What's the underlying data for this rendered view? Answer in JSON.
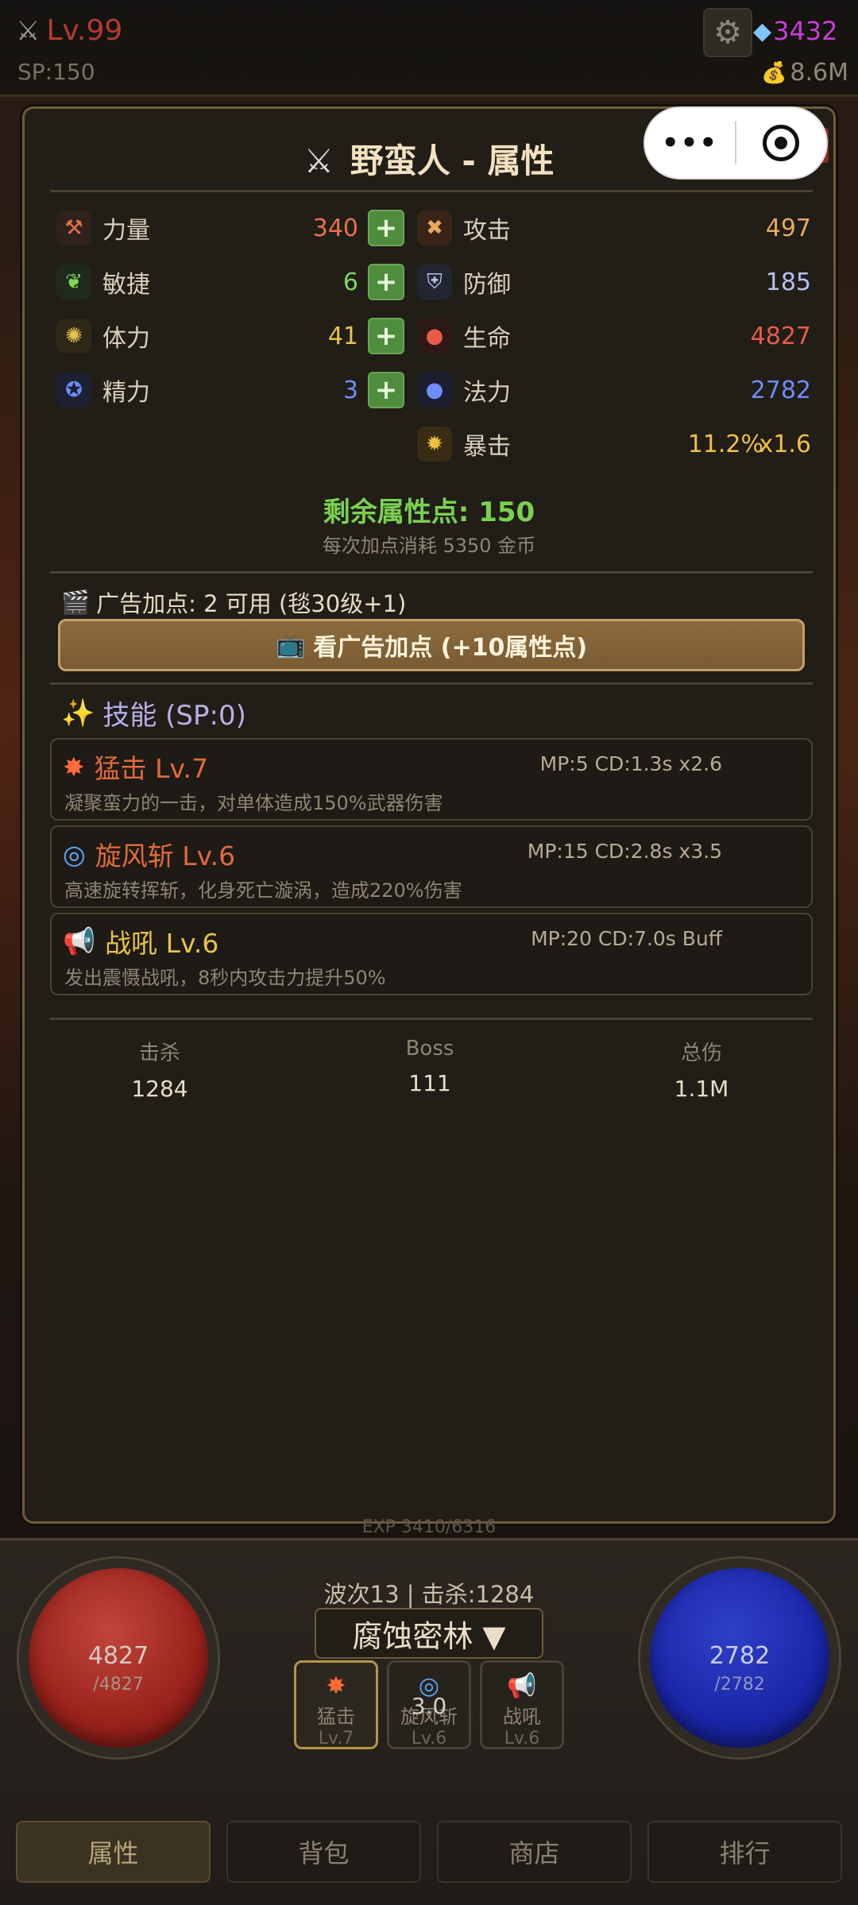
{
  "hud": {
    "level": "Lv.99",
    "sp": "SP:150",
    "gems": "3432",
    "gold": "8.6M"
  },
  "panel": {
    "title": "野蛮人 - 属性",
    "close_label": "X"
  },
  "mini_program": {
    "menu_label": "•••"
  },
  "stats_left": [
    {
      "label": "力量",
      "value": "340",
      "icon": "strength-icon"
    },
    {
      "label": "敏捷",
      "value": "6",
      "icon": "agility-icon"
    },
    {
      "label": "体力",
      "value": "41",
      "icon": "stamina-icon"
    },
    {
      "label": "精力",
      "value": "3",
      "icon": "energy-icon"
    }
  ],
  "stats_right": [
    {
      "label": "攻击",
      "value": "497",
      "icon": "attack-icon"
    },
    {
      "label": "防御",
      "value": "185",
      "icon": "defense-icon"
    },
    {
      "label": "生命",
      "value": "4827",
      "icon": "life-icon"
    },
    {
      "label": "法力",
      "value": "2782",
      "icon": "mana-icon"
    },
    {
      "label": "暴击",
      "value": "11.2%",
      "extra": "x1.6",
      "icon": "crit-icon"
    }
  ],
  "plus_label": "+",
  "points": {
    "remaining": "剩余属性点: 150",
    "cost": "每次加点消耗 5350 金币"
  },
  "ad": {
    "line": "广告加点: 2 可用 (毯30级+1)",
    "button": "看广告加点 (+10属性点)"
  },
  "skills": {
    "title": "技能 (SP:0)",
    "items": [
      {
        "name": "猛击 Lv.7",
        "meta": "MP:5 CD:1.3s x2.6",
        "desc": "凝聚蛮力的一击，对单体造成150%武器伤害",
        "icon": "burst-icon",
        "color": "#e26b3c"
      },
      {
        "name": "旋风斩 Lv.6",
        "meta": "MP:15 CD:2.8s x3.5",
        "desc": "高速旋转挥斩，化身死亡漩涡，造成220%伤害",
        "icon": "whirlwind-icon",
        "color": "#e26b3c"
      },
      {
        "name": "战吼 Lv.6",
        "meta": "MP:20 CD:7.0s Buff",
        "desc": "发出震慑战吼，8秒内攻击力提升50%",
        "icon": "megaphone-icon",
        "color": "#e8c24a"
      }
    ]
  },
  "totals": [
    {
      "label": "击杀",
      "value": "1284"
    },
    {
      "label": "Boss",
      "value": "111"
    },
    {
      "label": "总伤",
      "value": "1.1M"
    }
  ],
  "bottom": {
    "exp": "EXP 3410/6316",
    "hp": {
      "current": "4827",
      "max": "/4827"
    },
    "mp": {
      "current": "2782",
      "max": "/2782"
    },
    "wave": "波次13 | 击杀:1284",
    "zone": "腐蚀密林 ▼",
    "quick_skills": [
      {
        "name": "猛击",
        "level": "Lv.7",
        "cooldown": ""
      },
      {
        "name": "旋风斩",
        "level": "Lv.6",
        "cooldown": "3.0"
      },
      {
        "name": "战吼",
        "level": "Lv.6",
        "cooldown": ""
      }
    ]
  },
  "tabs": [
    "属性",
    "背包",
    "商店",
    "排行"
  ],
  "colors": {
    "strength": "#e8704a",
    "agility": "#7ed85a",
    "stamina": "#e6c253",
    "energy": "#6e8cff",
    "attack": "#e8a860",
    "defense": "#b6c0f0",
    "life": "#e85a4a",
    "mana": "#6e8cff",
    "crit": "#f0c040"
  }
}
